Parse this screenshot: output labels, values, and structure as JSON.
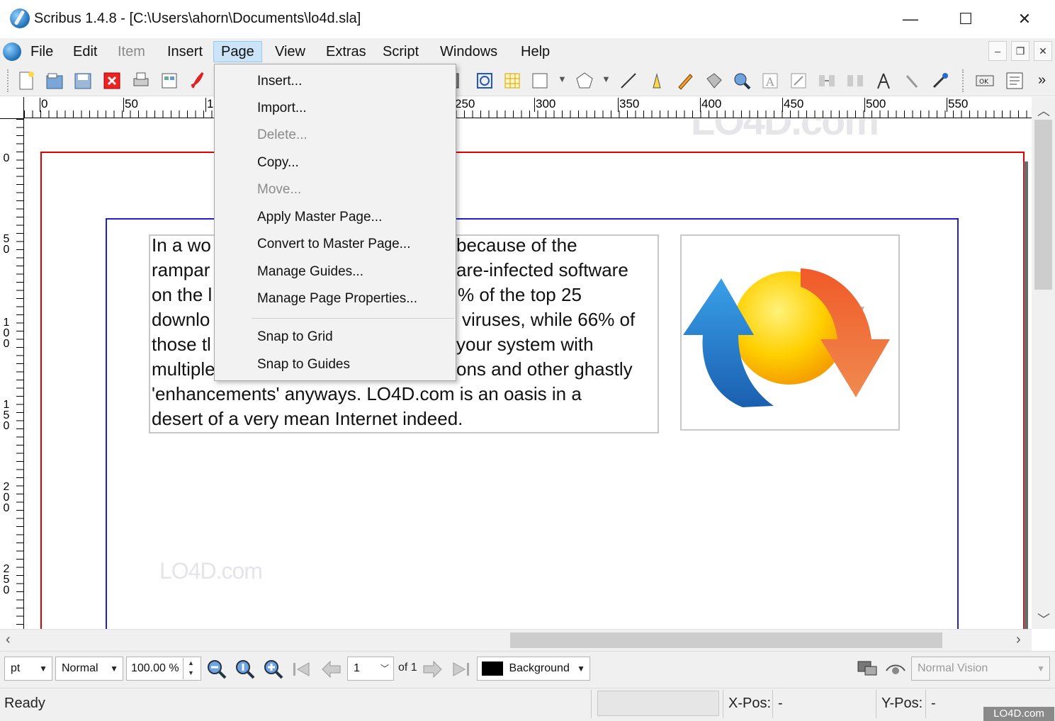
{
  "window": {
    "title": "Scribus 1.4.8 - [C:\\Users\\ahorn\\Documents\\lo4d.sla]",
    "minimize_glyph": "—",
    "maximize_glyph": "☐",
    "close_glyph": "✕"
  },
  "menubar": {
    "items": [
      {
        "label": "File"
      },
      {
        "label": "Edit"
      },
      {
        "label": "Item"
      },
      {
        "label": "Insert"
      },
      {
        "label": "Page"
      },
      {
        "label": "View"
      },
      {
        "label": "Extras"
      },
      {
        "label": "Script"
      },
      {
        "label": "Windows"
      },
      {
        "label": "Help"
      }
    ],
    "active": "Page"
  },
  "page_menu": {
    "items": [
      {
        "label": "Insert...",
        "enabled": true
      },
      {
        "label": "Import...",
        "enabled": true
      },
      {
        "label": "Delete...",
        "enabled": false
      },
      {
        "label": "Copy...",
        "enabled": true
      },
      {
        "label": "Move...",
        "enabled": false
      },
      {
        "label": "Apply Master Page...",
        "enabled": true
      },
      {
        "label": "Convert to Master Page...",
        "enabled": true
      },
      {
        "label": "Manage Guides...",
        "enabled": true
      },
      {
        "label": "Manage Page Properties...",
        "enabled": true
      },
      {
        "label": "Snap to Grid",
        "enabled": true
      },
      {
        "label": "Snap to Guides",
        "enabled": true
      }
    ]
  },
  "toolbar": {
    "overflow_glyph": "»",
    "icons": [
      "new-document-icon",
      "open-icon",
      "save-icon",
      "close-icon",
      "print-icon",
      "preflight-icon",
      "export-pdf-icon",
      "image-frame-icon",
      "render-frame-icon",
      "table-icon",
      "shape-icon",
      "polygon-icon",
      "line-icon",
      "bezier-icon",
      "freehand-icon",
      "rotate-icon",
      "zoom-icon",
      "edit-text-icon",
      "edit-contents-icon",
      "link-frames-icon",
      "unlink-frames-icon",
      "measure-icon",
      "copy-properties-icon",
      "eyedropper-icon",
      "pdf-button-icon",
      "pdf-textfield-icon"
    ]
  },
  "rulers": {
    "horizontal": [
      "0",
      "50",
      "1",
      "250",
      "300",
      "350",
      "400",
      "450",
      "500",
      "550"
    ],
    "vertical": [
      "0",
      "50",
      "100",
      "150",
      "200",
      "250"
    ]
  },
  "document": {
    "text_lines": [
      {
        "left": "In a wo",
        "right": "because of the"
      },
      {
        "left": "rampar",
        "right": "are-infected software"
      },
      {
        "left": "on the l",
        "right": "% of the top 25"
      },
      {
        "left": "downlo",
        "right": "viruses, while 66% of"
      },
      {
        "left": "those tl",
        "right": "your system with"
      },
      {
        "left": "multiple",
        "right": "ons and other ghastly"
      },
      {
        "left": "'enhancements' anyways. LO4D.com is an oasis in a",
        "right": ""
      },
      {
        "left": "desert of a very mean Internet indeed.",
        "right": ""
      }
    ],
    "watermark_text": "LO4D.com"
  },
  "controls": {
    "unit": "pt",
    "mode": "Normal",
    "zoom": "100.00 %",
    "page_number": "1",
    "page_total": "of 1",
    "layer": "Background",
    "layer_color": "#000000",
    "vision": "Normal Vision"
  },
  "status": {
    "message": "Ready",
    "xpos_label": "X-Pos:",
    "xpos_value": "-",
    "ypos_label": "Y-Pos:",
    "ypos_value": "-",
    "corner_watermark": "LO4D.com"
  },
  "colors": {
    "page_border": "#e00000",
    "margin_guide": "#1f1fd0",
    "menu_highlight": "#cce4f7"
  }
}
